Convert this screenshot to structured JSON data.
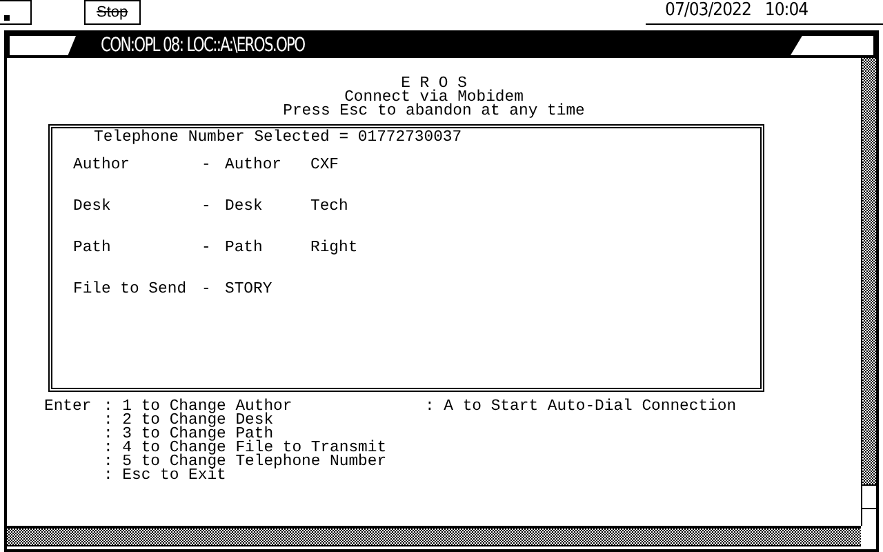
{
  "status_bar": {
    "stop_button": "Stop",
    "date": "07/03/2022",
    "time": "10:04"
  },
  "window": {
    "title": "CON:OPL 08: LOC::A:\\EROS.OPO"
  },
  "header": [
    "E R O S",
    "Connect via Mobidem",
    "Press Esc to abandon at any time"
  ],
  "panel": {
    "telephone": "Telephone Number Selected = 01772730037",
    "fields": [
      {
        "label": "Author",
        "separator": "-",
        "value": "Author",
        "setting": "CXF"
      },
      {
        "label": "Desk",
        "separator": "-",
        "value": "Desk",
        "setting": "Tech"
      },
      {
        "label": "Path",
        "separator": "-",
        "value": "Path",
        "setting": "Right"
      },
      {
        "label": "File to Send",
        "separator": "-",
        "value": "STORY"
      }
    ]
  },
  "menu": {
    "prompt": "Enter",
    "options": [
      ": 1 to Change Author",
      ": 2 to Change Desk",
      ": 3 to Change Path",
      ": 4 to Change File to Transmit",
      ": 5 to Change Telephone Number",
      ": Esc to Exit"
    ],
    "extra_option": ": A to Start Auto-Dial Connection"
  }
}
